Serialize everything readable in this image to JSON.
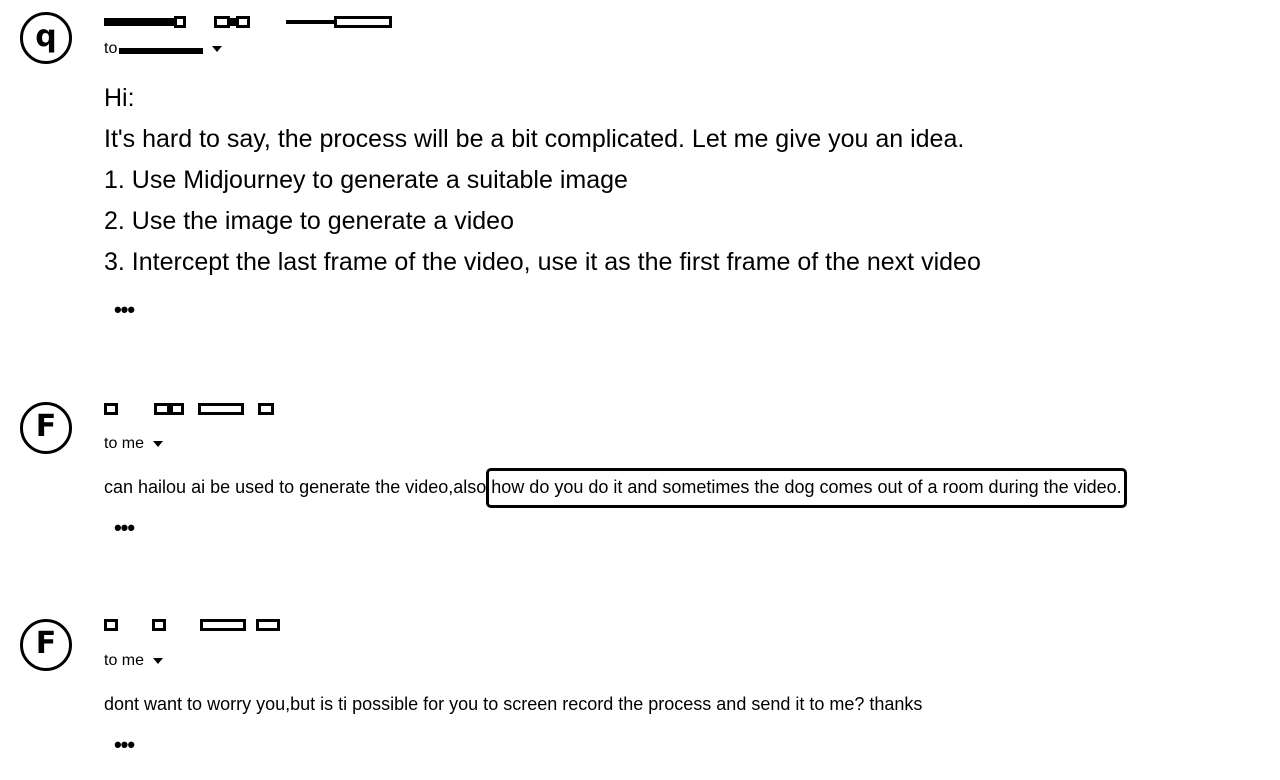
{
  "messages": [
    {
      "avatar_letter": "q",
      "to_label": "to",
      "body_lines": [
        "Hi:",
        "It's hard to say, the process will be a bit complicated. Let me give you an idea.",
        "1. Use Midjourney to generate a suitable image",
        "2. Use the image to generate a video",
        "3. Intercept the last frame of the video, use it as the first frame of the next video"
      ],
      "ellipsis": "•••"
    },
    {
      "avatar_letter": "F",
      "to_label": "to me",
      "body_before": "can hailou ai be used to generate the video,also",
      "body_highlight": "how do you do it and sometimes the dog comes out of a room during the video.",
      "ellipsis": "•••"
    },
    {
      "avatar_letter": "F",
      "to_label": "to me",
      "body": "dont want to worry you,but is ti possible for you to screen record the process and send it to me? thanks",
      "ellipsis": "•••"
    }
  ]
}
